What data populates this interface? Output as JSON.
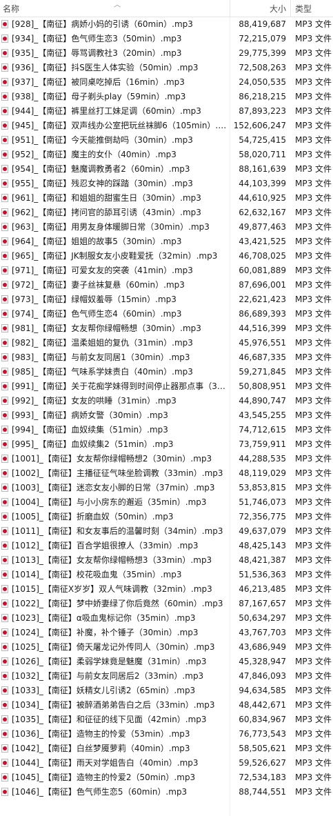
{
  "header": {
    "name": "名称",
    "size": "大小",
    "type": "类型"
  },
  "files": [
    {
      "name": "[928]_【南征】病娇小妈的引诱（60min）.mp3",
      "size": "88,419,687",
      "type": "MP3 文件"
    },
    {
      "name": "[934]_【南征】色气师生恋3（50min）.mp3",
      "size": "72,215,079",
      "type": "MP3 文件"
    },
    {
      "name": "[935]_【南征】辱骂调教社3（20min）.mp3",
      "size": "29,775,399",
      "type": "MP3 文件"
    },
    {
      "name": "[936]_【南征】抖S医生人体实验（50min）.mp3",
      "size": "72,508,263",
      "type": "MP3 文件"
    },
    {
      "name": "[937]_【南征】被同桌吃掉后（16min）.mp3",
      "size": "24,050,535",
      "type": "MP3 文件"
    },
    {
      "name": "[938]_【南征】母子剃头play（59min）.mp3",
      "size": "86,218,215",
      "type": "MP3 文件"
    },
    {
      "name": "[944]_【南征】裤里丝打工妹足调（60min）.mp3",
      "size": "87,893,223",
      "type": "MP3 文件"
    },
    {
      "name": "[945]_【南征】双声线办公室把玩丝袜脚6（105min）.mp3",
      "size": "152,606,247",
      "type": "MP3 文件"
    },
    {
      "name": "[951]_【南征】今天能推倒劫吗（30min）.mp3",
      "size": "54,725,415",
      "type": "MP3 文件"
    },
    {
      "name": "[952]_【南征】魔主的女仆（40min）.mp3",
      "size": "58,020,711",
      "type": "MP3 文件"
    },
    {
      "name": "[954]_【南征】魅魔调教勇者2（60min）.mp3",
      "size": "88,161,639",
      "type": "MP3 文件"
    },
    {
      "name": "[955]_【南征】残忍女神的踩踏（30min）.mp3",
      "size": "44,103,399",
      "type": "MP3 文件"
    },
    {
      "name": "[961]_【南征】和姐姐的甜蜜生日（30min）.mp3",
      "size": "44,610,925",
      "type": "MP3 文件"
    },
    {
      "name": "[962]_【南征】拷问官的舔耳引诱（43min）.mp3",
      "size": "62,632,167",
      "type": "MP3 文件"
    },
    {
      "name": "[963]_【南征】用男友身体暖脚日常（30min）.mp3",
      "size": "49,877,463",
      "type": "MP3 文件"
    },
    {
      "name": "[964]_【南征】姐姐的故事5（30min）.mp3",
      "size": "43,421,525",
      "type": "MP3 文件"
    },
    {
      "name": "[965]_【南征】JK制服女友小皮鞋爱抚（32min）.mp3",
      "size": "46,708,025",
      "type": "MP3 文件"
    },
    {
      "name": "[971]_【南征】可爱女友的突袭（41min）.mp3",
      "size": "60,081,889",
      "type": "MP3 文件"
    },
    {
      "name": "[972]_【南征】妻子丝袜复悬（60min）.mp3",
      "size": "87,696,001",
      "type": "MP3 文件"
    },
    {
      "name": "[973]_【南征】绿帽奴羞辱（15min）.mp3",
      "size": "22,621,423",
      "type": "MP3 文件"
    },
    {
      "name": "[974]_【南征】色气师生恋4（60min）.mp3",
      "size": "86,689,393",
      "type": "MP3 文件"
    },
    {
      "name": "[981]_【南征】女友帮你绿帽畅想（30min）.mp3",
      "size": "44,516,399",
      "type": "MP3 文件"
    },
    {
      "name": "[982]_【南征】温柔姐姐的复仇（31min）.mp3",
      "size": "45,976,551",
      "type": "MP3 文件"
    },
    {
      "name": "[983]_【南征】与前女友同居1（30min）.mp3",
      "size": "46,687,335",
      "type": "MP3 文件"
    },
    {
      "name": "[985]_【南征】气味系学妹责白（40min）.mp3",
      "size": "59,271,845",
      "type": "MP3 文件"
    },
    {
      "name": "[991]_【南征】关于花痴学妹得到时间停止器那点事（35min）.mp3",
      "size": "50,808,951",
      "type": "MP3 文件"
    },
    {
      "name": "[992]_【南征】女友的哄睡（31min）.mp3",
      "size": "44,890,747",
      "type": "MP3 文件"
    },
    {
      "name": "[993]_【南征】病娇女警（30min）.mp3",
      "size": "43,545,255",
      "type": "MP3 文件"
    },
    {
      "name": "[994]_【南征】血奴续集（51min）.mp3",
      "size": "74,712,615",
      "type": "MP3 文件"
    },
    {
      "name": "[995]_【南征】血奴续集2（51min）.mp3",
      "size": "73,759,911",
      "type": "MP3 文件"
    },
    {
      "name": "[1001]_【南征】女友帮你绿帽畅想2（30min）.mp3",
      "size": "44,288,535",
      "type": "MP3 文件"
    },
    {
      "name": "[1002]_【南征】主播征征气味坐脸调教（33min）.mp3",
      "size": "48,119,029",
      "type": "MP3 文件"
    },
    {
      "name": "[1003]_【南征】迷恋女友小脚的日常（37min）.mp3",
      "size": "53,853,815",
      "type": "MP3 文件"
    },
    {
      "name": "[1004]_【南征】与小小房东的邂逅（35min）.mp3",
      "size": "51,746,073",
      "type": "MP3 文件"
    },
    {
      "name": "[1005]_【南征】折磨血奴（50min）.mp3",
      "size": "72,356,775",
      "type": "MP3 文件"
    },
    {
      "name": "[1011]_【南征】和女友事后的温馨时刻（34min）.mp3",
      "size": "49,637,079",
      "type": "MP3 文件"
    },
    {
      "name": "[1012]_【南征】百合学姐很撩人（33min）.mp3",
      "size": "48,425,143",
      "type": "MP3 文件"
    },
    {
      "name": "[1013]_【南征】女友帮你绿帽畅想3（33min）.mp3",
      "size": "48,421,387",
      "type": "MP3 文件"
    },
    {
      "name": "[1014]_【南征】校花吸血鬼（35min）.mp3",
      "size": "51,536,363",
      "type": "MP3 文件"
    },
    {
      "name": "[1015]_【南征X岁岁】双人气味调教（32min）.mp3",
      "size": "46,213,485",
      "type": "MP3 文件"
    },
    {
      "name": "[1022]_【南征】梦中娇妻绿了你后竟然（60min）.mp3",
      "size": "87,167,657",
      "type": "MP3 文件"
    },
    {
      "name": "[1023]_【南征】α吸血鬼标记你（35min）.mp3",
      "size": "50,634,297",
      "type": "MP3 文件"
    },
    {
      "name": "[1024]_【南征】补魔，补个锤子（30min）.mp3",
      "size": "43,767,703",
      "type": "MP3 文件"
    },
    {
      "name": "[1025]_【南征】倚天屠龙记外传同人（30min）.mp3",
      "size": "43,686,949",
      "type": "MP3 文件"
    },
    {
      "name": "[1026]_【南征】柔弱学妹竟是魅魔（31min）.mp3",
      "size": "45,328,947",
      "type": "MP3 文件"
    },
    {
      "name": "[1032]_【南征】与前女友同居后2（33min）.mp3",
      "size": "47,846,093",
      "type": "MP3 文件"
    },
    {
      "name": "[1033]_【南征】妖精女儿引诱2（65min）.mp3",
      "size": "94,634,585",
      "type": "MP3 文件"
    },
    {
      "name": "[1034]_【南征】被醉酒弟弟告白之后（33min）.mp3",
      "size": "48,442,671",
      "type": "MP3 文件"
    },
    {
      "name": "[1035]_【南征】和征征的线下见面（42min）.mp3",
      "size": "60,834,967",
      "type": "MP3 文件"
    },
    {
      "name": "[1036]_【南征】造物主的怜爱（53min）.mp3",
      "size": "76,773,543",
      "type": "MP3 文件"
    },
    {
      "name": "[1042]_【南征】白丝梦魇萝莉（40min）.mp3",
      "size": "58,505,621",
      "type": "MP3 文件"
    },
    {
      "name": "[1044]_【南征】雨天对学姐告白（40min）.mp3",
      "size": "59,526,627",
      "type": "MP3 文件"
    },
    {
      "name": "[1045]_【南征】造物主的怜爱2（50min）.mp3",
      "size": "72,534,183",
      "type": "MP3 文件"
    },
    {
      "name": "[1046]_【南征】色气师生恋5（60min）.mp3",
      "size": "88,744,551",
      "type": "MP3 文件"
    }
  ]
}
